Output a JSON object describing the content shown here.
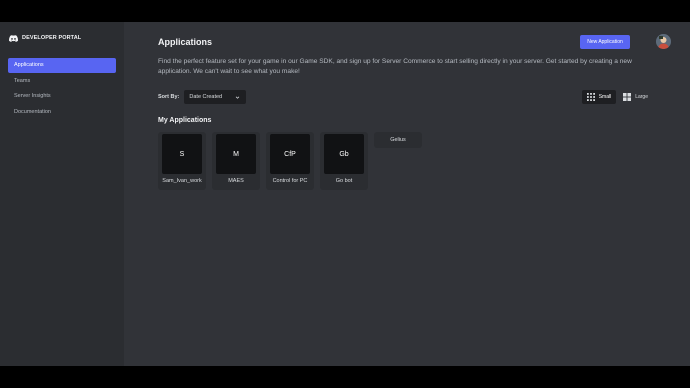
{
  "brand": {
    "title": "DEVELOPER PORTAL",
    "logo_icon": "discord-logo-icon"
  },
  "sidebar": {
    "items": [
      {
        "label": "Applications",
        "active": true
      },
      {
        "label": "Teams",
        "active": false
      },
      {
        "label": "Server Insights",
        "active": false
      },
      {
        "label": "Documentation",
        "active": false
      }
    ]
  },
  "header": {
    "title": "Applications",
    "new_application_label": "New Application",
    "avatar_icon": "user-avatar"
  },
  "intro": "Find the perfect feature set for your game in our Game SDK, and sign up for Server Commerce to start selling directly in your server. Get started by creating a new application. We can't wait to see what you make!",
  "sort": {
    "label": "Sort By:",
    "selected": "Date Created"
  },
  "view": {
    "small_label": "Small",
    "large_label": "Large",
    "selected": "Small"
  },
  "my_apps": {
    "title": "My Applications",
    "apps": [
      {
        "initials": "S",
        "name": "Sam_Ivan_work"
      },
      {
        "initials": "M",
        "name": "MAES"
      },
      {
        "initials": "CfP",
        "name": "Control for PC"
      },
      {
        "initials": "Gb",
        "name": "Go bot"
      },
      {
        "initials": "",
        "name": "Gelius"
      }
    ]
  },
  "colors": {
    "accent": "#5865f2",
    "sidebar_bg": "#2b2d31",
    "main_bg": "#313338",
    "card_icon_bg": "#111214"
  }
}
